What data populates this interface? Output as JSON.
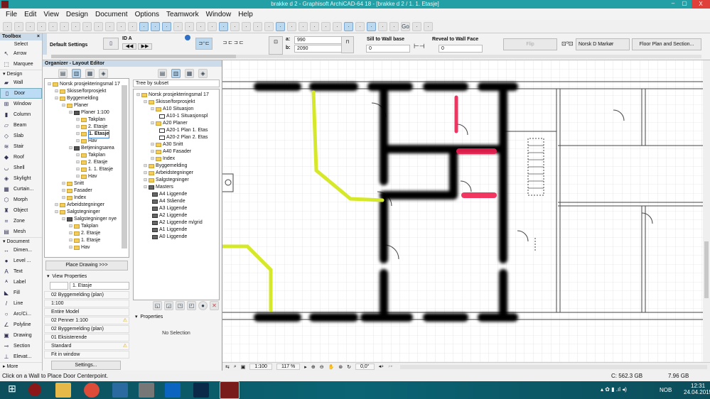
{
  "window": {
    "title": "brakke d 2 - Graphisoft ArchiCAD-64 18 - [brakke d 2 / 1. 1. Etasje]",
    "min": "–",
    "max": "▢",
    "close": "X"
  },
  "menu": [
    "File",
    "Edit",
    "View",
    "Design",
    "Document",
    "Options",
    "Teamwork",
    "Window",
    "Help"
  ],
  "toolbox": {
    "title": "Toolbox",
    "close": "×",
    "select_label": "Select",
    "select_tools": [
      {
        "label": "Arrow",
        "icon": "↖"
      },
      {
        "label": "Marquee",
        "icon": "⬚"
      }
    ],
    "design_label": "Design",
    "design_tools": [
      {
        "label": "Wall",
        "icon": "▰"
      },
      {
        "label": "Door",
        "icon": "▯"
      },
      {
        "label": "Window",
        "icon": "⊞"
      },
      {
        "label": "Column",
        "icon": "▮"
      },
      {
        "label": "Beam",
        "icon": "▱"
      },
      {
        "label": "Slab",
        "icon": "◇"
      },
      {
        "label": "Stair",
        "icon": "≋"
      },
      {
        "label": "Roof",
        "icon": "◆"
      },
      {
        "label": "Shell",
        "icon": "◡"
      },
      {
        "label": "Skylight",
        "icon": "◈"
      },
      {
        "label": "Curtain...",
        "icon": "▦"
      },
      {
        "label": "Morph",
        "icon": "⬡"
      },
      {
        "label": "Object",
        "icon": "♜"
      },
      {
        "label": "Zone",
        "icon": "⌗"
      },
      {
        "label": "Mesh",
        "icon": "▤"
      }
    ],
    "document_label": "Document",
    "document_tools": [
      {
        "label": "Dimen...",
        "icon": "↔"
      },
      {
        "label": "Level ...",
        "icon": "●"
      },
      {
        "label": "Text",
        "icon": "A"
      },
      {
        "label": "Label",
        "icon": "ᴬ"
      },
      {
        "label": "Fill",
        "icon": "◣"
      },
      {
        "label": "Line",
        "icon": "/"
      },
      {
        "label": "Arc/Ci...",
        "icon": "○"
      },
      {
        "label": "Polyline",
        "icon": "∠"
      },
      {
        "label": "Drawing",
        "icon": "▣"
      },
      {
        "label": "Section",
        "icon": "⊸"
      },
      {
        "label": "Elevat...",
        "icon": "⊥"
      }
    ],
    "more_label": "More",
    "selected": "Door"
  },
  "infobox": {
    "default_settings": "Default Settings",
    "id": "ID A",
    "a_label": "a:",
    "a_value": "990",
    "b_label": "b:",
    "b_value": "2090",
    "sill_label": "Sill to Wall base",
    "sill_value": "0",
    "reveal_label": "Reveal to Wall Face",
    "reveal_value": "0",
    "flip_label": "Flip",
    "marker": "Norsk D Markør",
    "floorplan_button": "Floor Plan and Section..."
  },
  "organizer": {
    "title": "Organizer - Layout Editor",
    "view_tree": [
      {
        "label": "Norsk prosjekteringsmal 17",
        "level": 0,
        "type": "root"
      },
      {
        "label": "Skisse/forprosjekt",
        "level": 1,
        "type": "folder"
      },
      {
        "label": "Byggemelding",
        "level": 1,
        "type": "folder"
      },
      {
        "label": "Planer",
        "level": 2,
        "type": "folder"
      },
      {
        "label": "Planer 1:100",
        "level": 3,
        "type": "view"
      },
      {
        "label": "Takplan",
        "level": 4,
        "type": "folder"
      },
      {
        "label": "2. Etasje",
        "level": 4,
        "type": "folder"
      },
      {
        "label": "1. Etasje",
        "level": 4,
        "type": "folder",
        "selected": true
      },
      {
        "label": "Hav",
        "level": 4,
        "type": "folder"
      },
      {
        "label": "Betjeningsarea",
        "level": 3,
        "type": "view"
      },
      {
        "label": "Takplan",
        "level": 4,
        "type": "folder"
      },
      {
        "label": "2. Etasje",
        "level": 4,
        "type": "folder"
      },
      {
        "label": "1. 1. Etasje",
        "level": 4,
        "type": "folder"
      },
      {
        "label": "Hav",
        "level": 4,
        "type": "folder"
      },
      {
        "label": "Snitt",
        "level": 2,
        "type": "folder"
      },
      {
        "label": "Fasader",
        "level": 2,
        "type": "folder"
      },
      {
        "label": "Index",
        "level": 2,
        "type": "folder"
      },
      {
        "label": "Arbeidstegninger",
        "level": 1,
        "type": "folder"
      },
      {
        "label": "Salgstegninger",
        "level": 1,
        "type": "folder"
      },
      {
        "label": "Salgstegninger nye",
        "level": 2,
        "type": "view"
      },
      {
        "label": "Takplan",
        "level": 3,
        "type": "folder"
      },
      {
        "label": "2. Etasje",
        "level": 3,
        "type": "folder"
      },
      {
        "label": "1. Etasje",
        "level": 3,
        "type": "folder"
      },
      {
        "label": "Hav",
        "level": 3,
        "type": "folder"
      }
    ],
    "layout_dropdown": "Tree by subset",
    "layout_tree": [
      {
        "label": "Norsk prosjekteringsmal 17",
        "level": 0,
        "type": "root"
      },
      {
        "label": "Skisse/forprosjekt",
        "level": 1,
        "type": "folder"
      },
      {
        "label": "A10 Situasjon",
        "level": 2,
        "type": "folder"
      },
      {
        "label": "A10-1 Situasjonspl",
        "level": 3,
        "type": "layout"
      },
      {
        "label": "A20 Planer",
        "level": 2,
        "type": "folder"
      },
      {
        "label": "A20-1 Plan 1. Etas",
        "level": 3,
        "type": "layout"
      },
      {
        "label": "A20-2 Plan 2. Etas",
        "level": 3,
        "type": "layout"
      },
      {
        "label": "A30 Snitt",
        "level": 2,
        "type": "folder"
      },
      {
        "label": "A40 Fasader",
        "level": 2,
        "type": "folder"
      },
      {
        "label": "Index",
        "level": 2,
        "type": "folder"
      },
      {
        "label": "Byggemelding",
        "level": 1,
        "type": "folder"
      },
      {
        "label": "Arbeidstegninger",
        "level": 1,
        "type": "folder"
      },
      {
        "label": "Salgstegninger",
        "level": 1,
        "type": "folder"
      },
      {
        "label": "Masters",
        "level": 1,
        "type": "master"
      },
      {
        "label": "A4 Liggende",
        "level": 2,
        "type": "master"
      },
      {
        "label": "A4 Stående",
        "level": 2,
        "type": "master"
      },
      {
        "label": "A3 Liggende",
        "level": 2,
        "type": "master"
      },
      {
        "label": "A2 Liggende",
        "level": 2,
        "type": "master"
      },
      {
        "label": "A2 Liggende m/grid",
        "level": 2,
        "type": "master"
      },
      {
        "label": "A1 Liggende",
        "level": 2,
        "type": "master"
      },
      {
        "label": "A0 Liggende",
        "level": 2,
        "type": "master"
      }
    ],
    "place_drawing": "Place Drawing >>>",
    "view_properties": {
      "title": "View Properties",
      "name": "1. Etasje",
      "rows": [
        {
          "value": "02 Byggemelding (plan)",
          "warn": false
        },
        {
          "value": "1:100",
          "warn": false
        },
        {
          "value": "Entire Model",
          "warn": false
        },
        {
          "value": "02 Penner 1:100",
          "warn": true
        },
        {
          "value": "02 Byggemelding (plan)",
          "warn": false
        },
        {
          "value": "01 Eksisterende",
          "warn": false
        },
        {
          "value": "Standard",
          "warn": true
        },
        {
          "value": "Fit in window",
          "warn": false
        }
      ],
      "settings_button": "Settings..."
    },
    "properties": {
      "title": "Properties",
      "empty": "No Selection"
    }
  },
  "canvas_bar": {
    "scale": "1:100",
    "zoom": "117 %",
    "angle": "0,0°"
  },
  "status": {
    "message": "Click on a Wall to Place Door Centerpoint.",
    "disk": "C: 562.3 GB",
    "ram": "7.96 GB"
  },
  "taskbar": {
    "lang": "NOB",
    "time": "12:31",
    "date": "24.04.2015"
  },
  "colors": {
    "titlebar": "#23a0a6",
    "highlight_yellow": "#d6e82a",
    "highlight_red": "#ee2050",
    "wall": "#000000"
  }
}
